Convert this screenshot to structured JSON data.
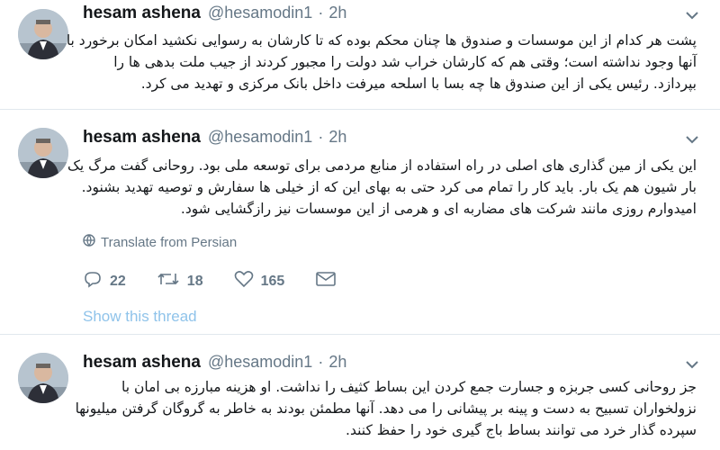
{
  "tweets": [
    {
      "name": "hesam ashena",
      "handle": "@hesamodin1",
      "dot": "·",
      "time": "2h",
      "lines": [
        "پشت هر کدام از این موسسات و صندوق ها چنان محکم بوده که تا کارشان به رسوایی نکشید امکان برخورد با",
        "آنها وجود نداشته است؛ وقتی هم که کارشان خراب شد دولت را مجبور کردند از جیب ملت بدهی ها را",
        "بپردازد. رئیس یکی از این صندوق ها چه بسا با اسلحه میرفت داخل بانک مرکزی و تهدید می کرد."
      ]
    },
    {
      "name": "hesam ashena",
      "handle": "@hesamodin1",
      "dot": "·",
      "time": "2h",
      "lines": [
        "این یکی از مین گذاری های اصلی در راه استفاده از منابع مردمی برای توسعه ملی بود. روحانی گفت مرگ یک",
        "بار شیون هم یک بار. باید کار را تمام می کرد حتی به بهای این که از خیلی ها سفارش و توصیه تهدید بشنود.",
        "امیدوارم روزی مانند شرکت های مضاربه ای و هرمی از این موسسات نیز رازگشایی شود."
      ],
      "translate_label": "Translate from Persian",
      "replies": "22",
      "retweets": "18",
      "likes": "165",
      "show_thread": "Show this thread"
    },
    {
      "name": "hesam ashena",
      "handle": "@hesamodin1",
      "dot": "·",
      "time": "2h",
      "lines": [
        "جز روحانی کسی جربزه و جسارت جمع کردن این بساط کثیف را نداشت. او هزینه مبارزه بی امان با",
        "نزولخواران تسبیح به دست و پینه بر پیشانی را می دهد. آنها مطمئن بودند به خاطر به گروگان گرفتن میلیونها",
        "سپرده گذار خرد می توانند بساط باج گیری خود را حفظ کنند."
      ]
    }
  ],
  "colors": {
    "name": "#14171a",
    "meta": "#657786",
    "link": "#8fc3ea",
    "divider": "#e1e8ed"
  },
  "icons": [
    "avatar",
    "chevron-down-icon",
    "globe-icon",
    "reply-icon",
    "retweet-icon",
    "heart-icon",
    "mail-icon"
  ]
}
